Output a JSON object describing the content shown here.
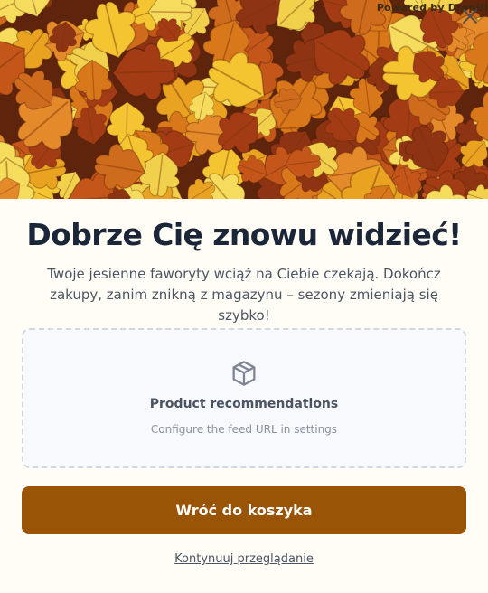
{
  "popup": {
    "powered_by": "Powered by DropUI",
    "title": "Dobrze Cię znowu widzieć!",
    "subtitle": "Twoje jesienne faworyty wciąż na Ciebie czekają. Dokończ zakupy, zanim znikną z magazynu – sezony zmieniają się szybko!",
    "close_icon": "close-icon",
    "hero_image": "autumn-leaves-photo",
    "recommendations": {
      "icon": "package-icon",
      "title": "Product recommendations",
      "subtitle": "Configure the feed URL in settings"
    },
    "primary_button": "Wróć do koszyka",
    "secondary_link": "Kontynuuj przeglądanie"
  },
  "colors": {
    "accent": "#9a5406",
    "title": "#1b2638",
    "background": "#fffdf5"
  }
}
